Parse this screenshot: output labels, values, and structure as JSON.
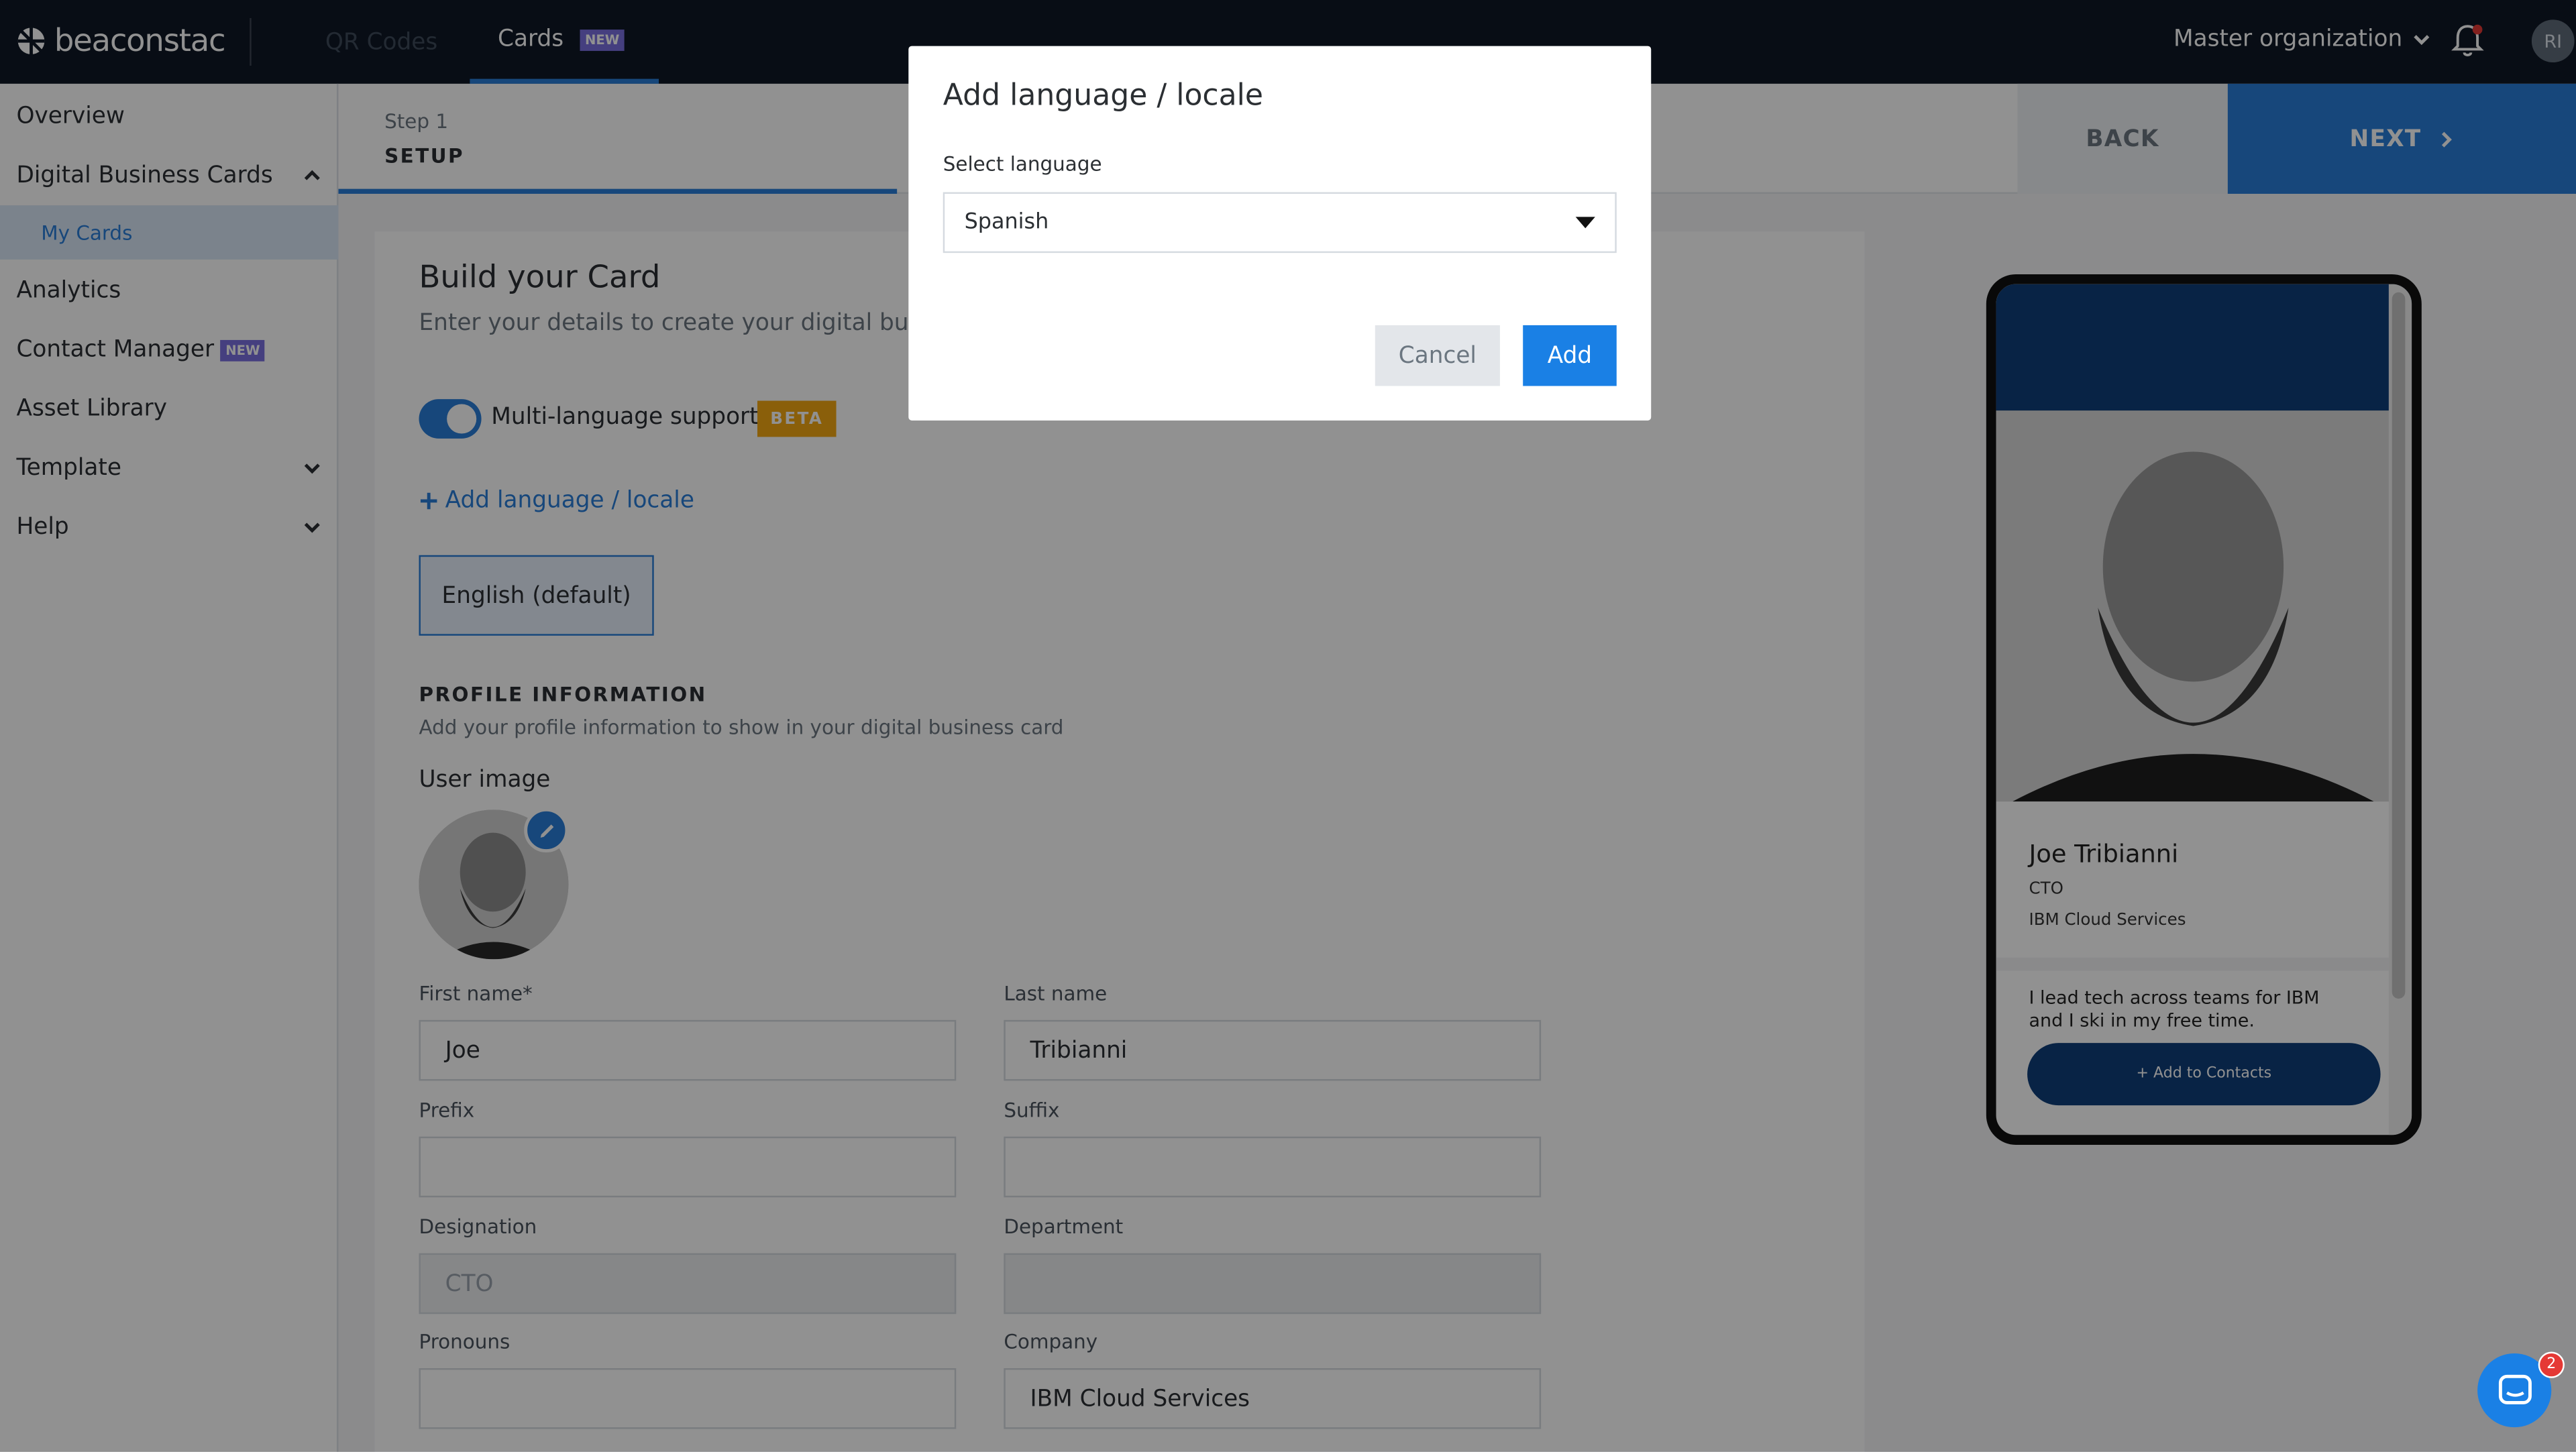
{
  "brand": {
    "name": "beaconstac"
  },
  "topnav": {
    "tabs": [
      {
        "label": "QR Codes"
      },
      {
        "label": "Cards",
        "badge": "NEW"
      }
    ],
    "org_label": "Master organization",
    "avatar_initials": "RI"
  },
  "sidebar": {
    "items": [
      {
        "label": "Overview"
      },
      {
        "label": "Digital Business Cards"
      },
      {
        "label": "My Cards"
      },
      {
        "label": "Analytics"
      },
      {
        "label": "Contact Manager",
        "badge": "NEW"
      },
      {
        "label": "Asset Library"
      },
      {
        "label": "Template"
      },
      {
        "label": "Help"
      }
    ]
  },
  "stepbar": {
    "step_num": "Step 1",
    "step_name": "SETUP",
    "back_label": "BACK",
    "next_label": "NEXT"
  },
  "form": {
    "title": "Build your Card",
    "subtitle": "Enter your details to create your digital busin",
    "multilang_label": "Multi-language support",
    "multilang_badge": "BETA",
    "multilang_enabled": true,
    "add_language_link": "Add language / locale",
    "default_language": "English (default)",
    "profile_section_title": "PROFILE INFORMATION",
    "profile_section_sub": "Add your profile information to show in your digital business card",
    "user_image_label": "User image",
    "fields": {
      "first_name": {
        "label": "First name*",
        "value": "Joe"
      },
      "last_name": {
        "label": "Last name",
        "value": "Tribianni"
      },
      "prefix": {
        "label": "Prefix",
        "value": ""
      },
      "suffix": {
        "label": "Suffix",
        "value": ""
      },
      "designation": {
        "label": "Designation",
        "value": "CTO"
      },
      "department": {
        "label": "Department",
        "value": ""
      },
      "pronouns": {
        "label": "Pronouns",
        "value": ""
      },
      "company": {
        "label": "Company",
        "value": "IBM Cloud Services"
      }
    }
  },
  "preview": {
    "name": "Joe Tribianni",
    "title": "CTO",
    "company": "IBM Cloud Services",
    "bio": "I lead tech across teams for IBM and I ski in my free time.",
    "cta": "+ Add to Contacts",
    "header_color": "#0f3e7a"
  },
  "modal": {
    "title": "Add language / locale",
    "select_label": "Select language",
    "selected_language": "Spanish",
    "cancel_label": "Cancel",
    "add_label": "Add"
  },
  "chat": {
    "unread_count": "2"
  },
  "colors": {
    "accent": "#2a7ed8",
    "topbar": "#0f1826",
    "beta": "#f3a712",
    "new_badge": "#7a6fe0"
  }
}
